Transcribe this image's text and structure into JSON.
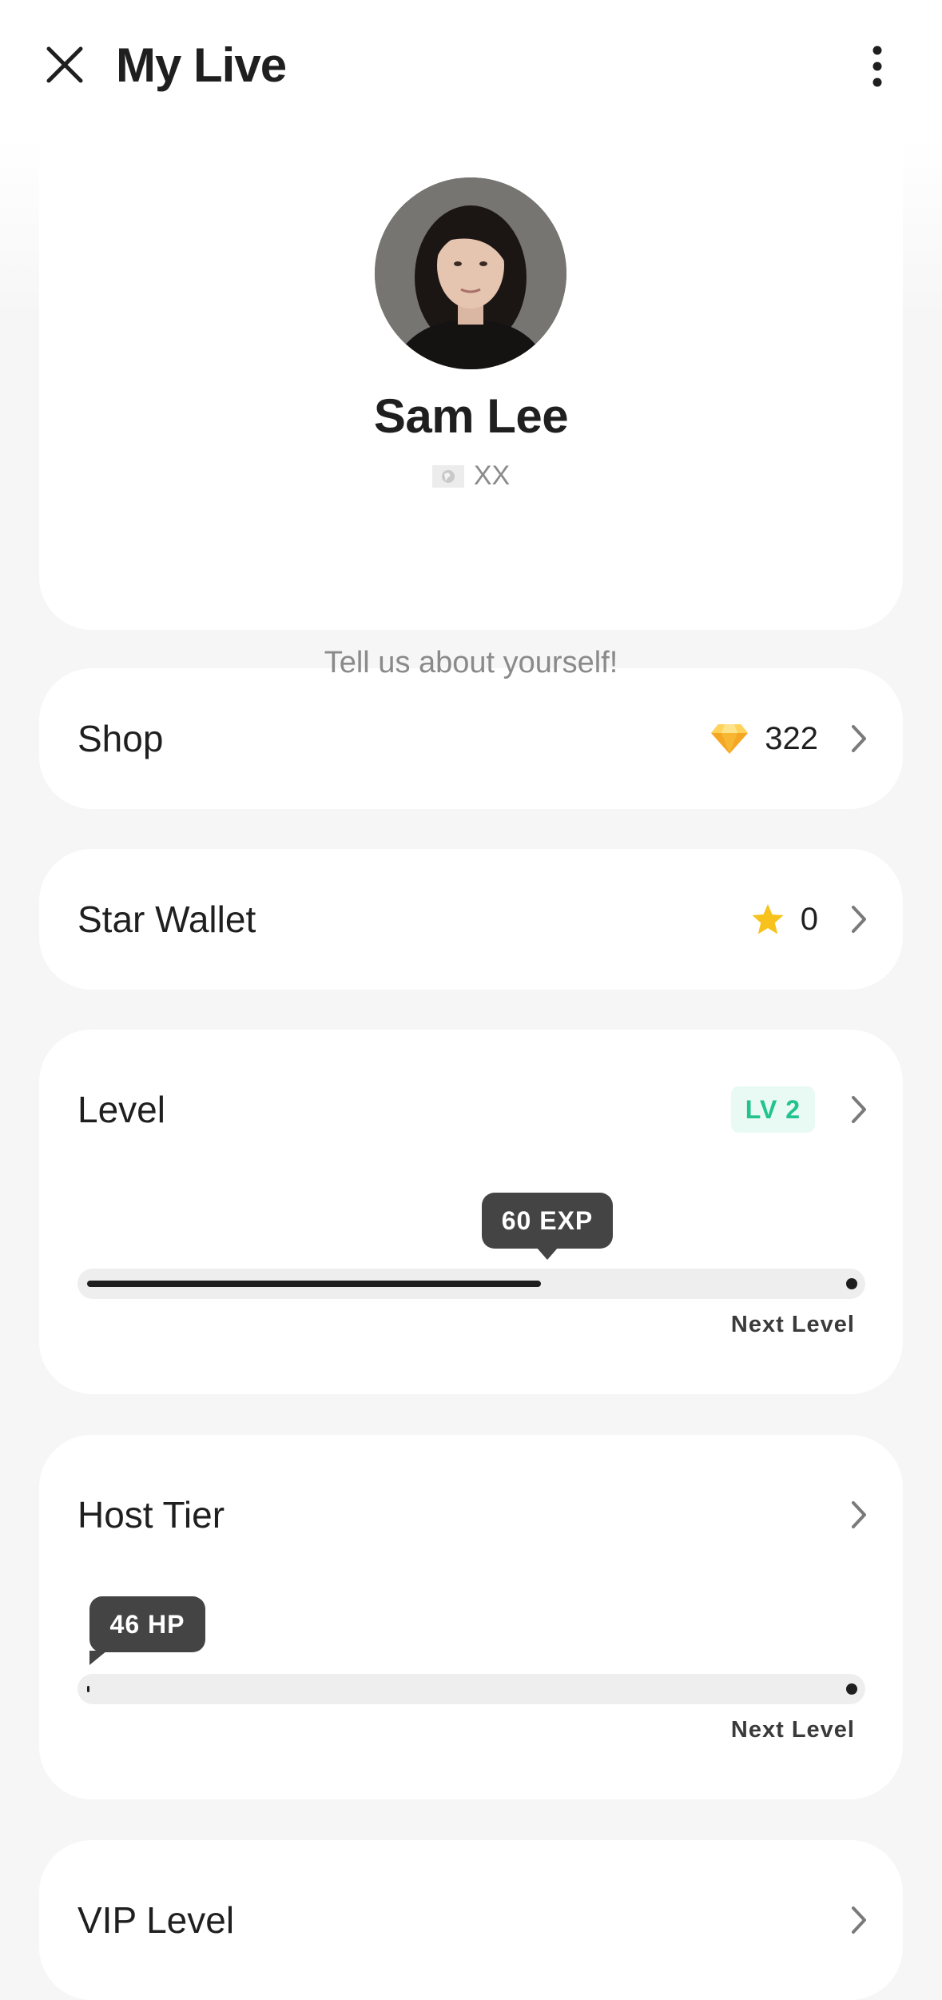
{
  "header": {
    "title": "My Live",
    "close_icon": "close-icon",
    "more_icon": "more-vertical-icon"
  },
  "profile": {
    "name": "Sam Lee",
    "country_code": "XX",
    "flag_icon": "flag-icon",
    "bio_placeholder": "Tell us about yourself!"
  },
  "shop": {
    "label": "Shop",
    "value": "322",
    "icon": "diamond-icon"
  },
  "star_wallet": {
    "label": "Star Wallet",
    "value": "0",
    "icon": "star-icon"
  },
  "level": {
    "label": "Level",
    "badge": "LV 2",
    "progress_label": "60 EXP",
    "progress_fraction": 0.59,
    "next_level_label": "Next Level"
  },
  "host_tier": {
    "label": "Host Tier",
    "progress_label": "46 HP",
    "progress_fraction": 0.0,
    "next_level_label": "Next Level"
  },
  "vip_level": {
    "label": "VIP Level"
  },
  "colors": {
    "accent_green": "#22c38f",
    "badge_bg": "#e8faf3",
    "diamond": "#f5a623",
    "star": "#f7c21b",
    "bubble": "#444444",
    "background": "#f6f6f6"
  }
}
